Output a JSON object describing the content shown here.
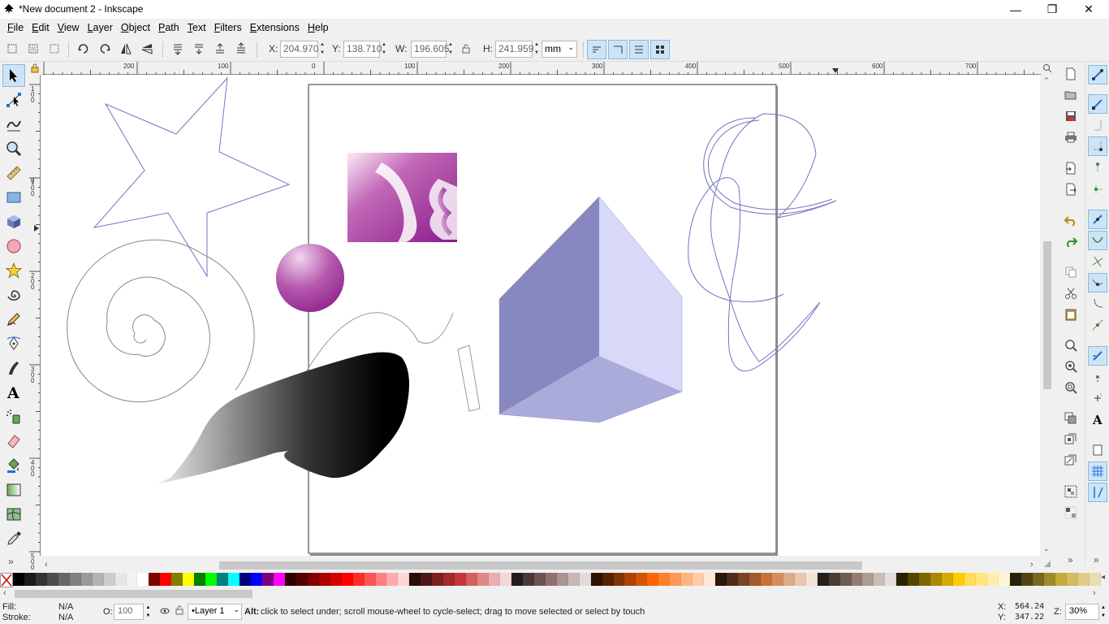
{
  "window": {
    "title": "*New document 2 - Inkscape",
    "minimize": "—",
    "restore": "❐",
    "close": "✕"
  },
  "menu": [
    "File",
    "Edit",
    "View",
    "Layer",
    "Object",
    "Path",
    "Text",
    "Filters",
    "Extensions",
    "Help"
  ],
  "controls": {
    "x_label": "X:",
    "x_value": "204.970",
    "y_label": "Y:",
    "y_value": "138.710",
    "w_label": "W:",
    "w_value": "196.605",
    "h_label": "H:",
    "h_value": "241.959",
    "unit": "mm"
  },
  "hruler_labels": [
    "200",
    "100",
    "0",
    "100",
    "200",
    "300",
    "400",
    "500",
    "600",
    "700"
  ],
  "vruler_labels": [
    "1\n0\n0",
    "0",
    "1\n0\n0",
    "2\n0\n0",
    "3\n0\n0",
    "4\n0\n0",
    "5\n0\n0"
  ],
  "status": {
    "fill_label": "Fill:",
    "fill_value": "N/A",
    "stroke_label": "Stroke:",
    "stroke_value": "N/A",
    "opacity_label": "O:",
    "opacity_value": "100",
    "layer": "•Layer 1",
    "message_bold": "Alt:",
    "message": " click to select under; scroll mouse-wheel to cycle-select; drag to move selected or select by touch",
    "cursor_x_label": "X:",
    "cursor_x": "564.24",
    "cursor_y_label": "Y:",
    "cursor_y": "347.22",
    "zoom_label": "Z:",
    "zoom": "30%"
  },
  "palette_colors": [
    "#000000",
    "#1a1a1a",
    "#333333",
    "#4d4d4d",
    "#666666",
    "#808080",
    "#999999",
    "#b3b3b3",
    "#cccccc",
    "#e6e6e6",
    "#f2f2f2",
    "#ffffff",
    "#800000",
    "#ff0000",
    "#808000",
    "#ffff00",
    "#008000",
    "#00ff00",
    "#008080",
    "#00ffff",
    "#000080",
    "#0000ff",
    "#800080",
    "#ff00ff",
    "#2b0000",
    "#550000",
    "#800000",
    "#aa0000",
    "#d40000",
    "#ff0000",
    "#ff2a2a",
    "#ff5555",
    "#ff8080",
    "#ffaaaa",
    "#ffd5d5",
    "#280b0b",
    "#501616",
    "#782121",
    "#a02c2c",
    "#c83737",
    "#d35f5f",
    "#de8787",
    "#e9afaf",
    "#f4d7d7",
    "#241c1c",
    "#483737",
    "#6c5353",
    "#916f6f",
    "#ac9393",
    "#c8b7b7",
    "#e3dbdb",
    "#2b1100",
    "#552200",
    "#803300",
    "#aa4400",
    "#d45500",
    "#ff6600",
    "#ff7f2a",
    "#ff9955",
    "#ffb380",
    "#ffccaa",
    "#ffe6d5",
    "#28170b",
    "#502d16",
    "#784421",
    "#a05a2c",
    "#c87137",
    "#d38d5f",
    "#deaa87",
    "#e9c6af",
    "#f4e3d7",
    "#241f1c",
    "#483e37",
    "#6c5d53",
    "#917c6f",
    "#ac9d93",
    "#c8beb7",
    "#e3dedb",
    "#2b2200",
    "#554400",
    "#806600",
    "#aa8800",
    "#d4aa00",
    "#ffcc00",
    "#ffdd55",
    "#ffe680",
    "#ffeeaa",
    "#fff6d5",
    "#28220b",
    "#504416",
    "#786721",
    "#a0892c",
    "#c8ab37",
    "#d3bc5f",
    "#decd87",
    "#e9ddaf"
  ]
}
